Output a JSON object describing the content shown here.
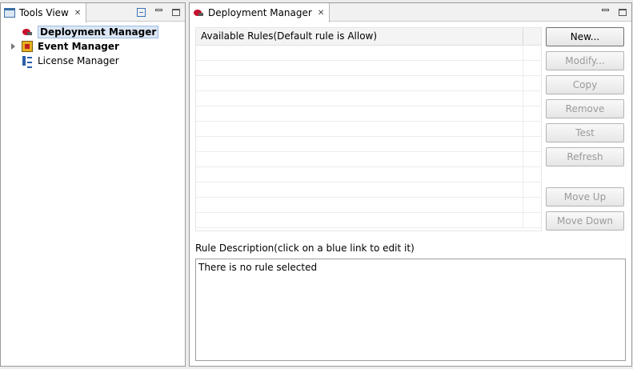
{
  "tools_view": {
    "tab_title": "Tools View",
    "tree": [
      {
        "label": "Deployment Manager",
        "bold": true,
        "selected": true,
        "icon": "deployment-manager-icon"
      },
      {
        "label": "Event Manager",
        "bold": true,
        "expandable": true,
        "icon": "event-manager-icon"
      },
      {
        "label": "License Manager",
        "bold": false,
        "icon": "license-manager-icon"
      }
    ]
  },
  "deployment_manager": {
    "tab_title": "Deployment Manager",
    "table_header": "Available Rules(Default rule is Allow)",
    "rows": 12,
    "buttons": {
      "new": "New...",
      "modify": "Modify...",
      "copy": "Copy",
      "remove": "Remove",
      "test": "Test",
      "refresh": "Refresh",
      "move_up": "Move Up",
      "move_down": "Move Down"
    },
    "description_label": "Rule Description(click on a blue link to edit it)",
    "description_text": "There is no rule selected"
  },
  "colors": {
    "selection_bg": "#dbe7f5",
    "selection_border": "#9fbbe1",
    "disabled_text": "#9a9a9a"
  }
}
